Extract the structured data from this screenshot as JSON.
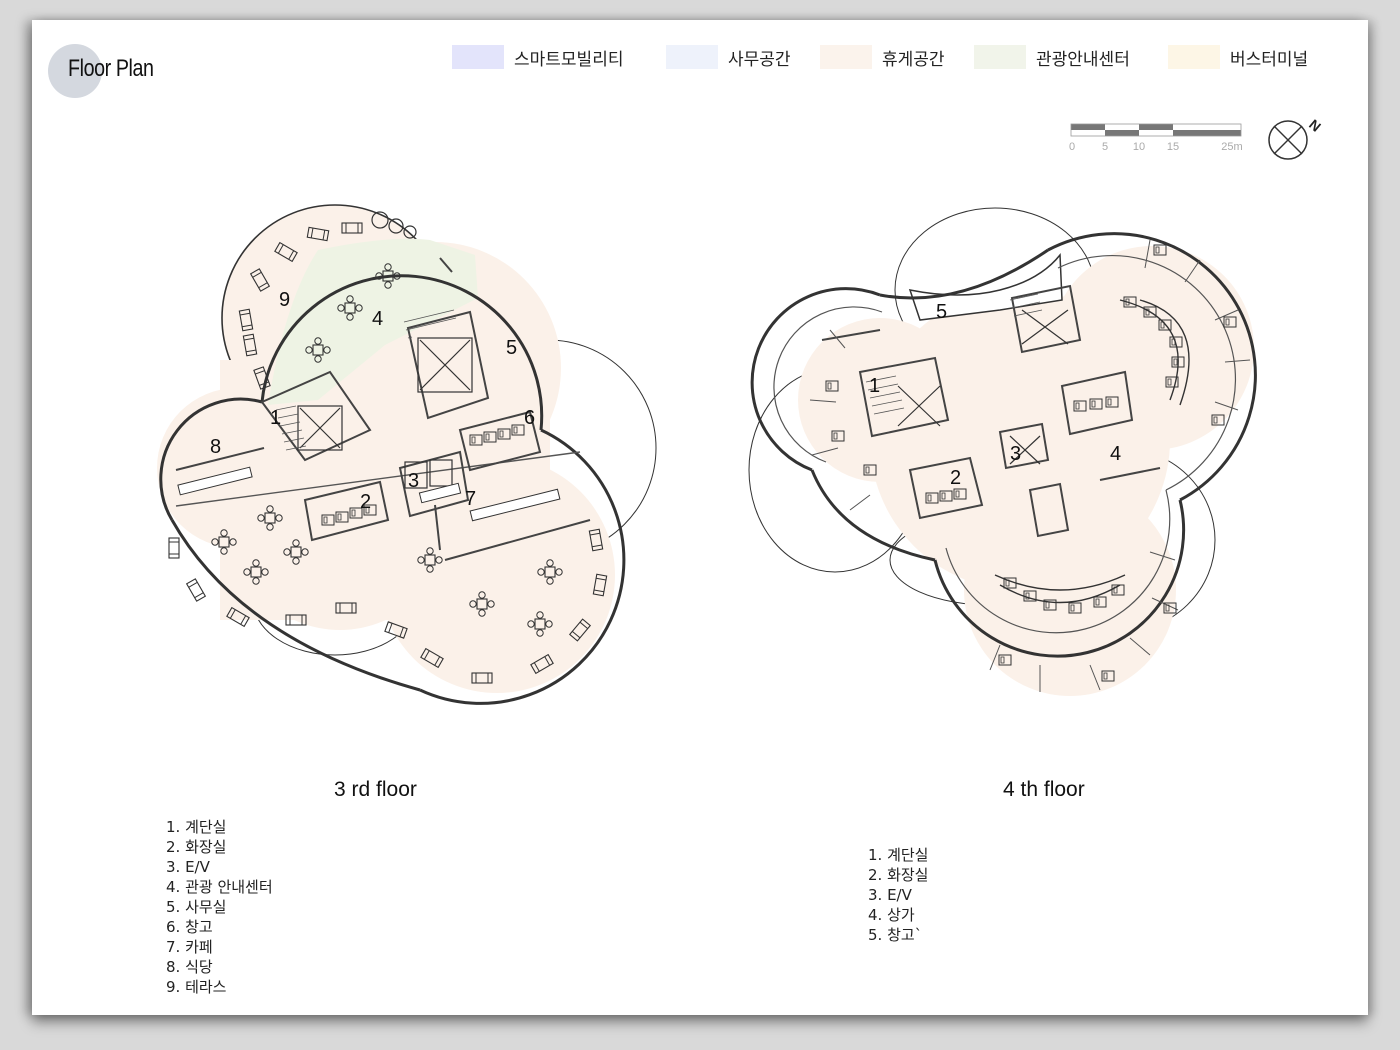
{
  "title": "Floor Plan",
  "legend": [
    {
      "label": "스마트모빌리티",
      "color": "#e3e4fb"
    },
    {
      "label": "사무공간",
      "color": "#eef2fb"
    },
    {
      "label": "휴게공간",
      "color": "#fbf3ec"
    },
    {
      "label": "관광안내센터",
      "color": "#f1f4ea"
    },
    {
      "label": "버스터미널",
      "color": "#fdf6e6"
    }
  ],
  "scale_bar": {
    "ticks": [
      "0",
      "5",
      "10",
      "15",
      "25m"
    ]
  },
  "north_arrow": {
    "label": "N"
  },
  "floors": [
    {
      "title": "3 rd floor",
      "plan_labels": [
        "9",
        "4",
        "5",
        "1",
        "6",
        "8",
        "3",
        "2",
        "7"
      ],
      "rooms": [
        "1. 계단실",
        "2. 화장실",
        "3. E/V",
        "4. 관광 안내센터",
        "5. 사무실",
        "6. 창고",
        "7. 카페",
        "8. 식당",
        "9. 테라스"
      ]
    },
    {
      "title": "4 th floor",
      "plan_labels": [
        "5",
        "1",
        "3",
        "2",
        "4"
      ],
      "rooms": [
        "1. 계단실",
        "2. 화장실",
        "3. E/V",
        "4. 상가",
        "5. 창고`"
      ]
    }
  ],
  "colors": {
    "rest_fill": "#fbf1e9",
    "tourist_fill": "#eef3e4",
    "wall": "#333333",
    "background": "#ffffff"
  }
}
